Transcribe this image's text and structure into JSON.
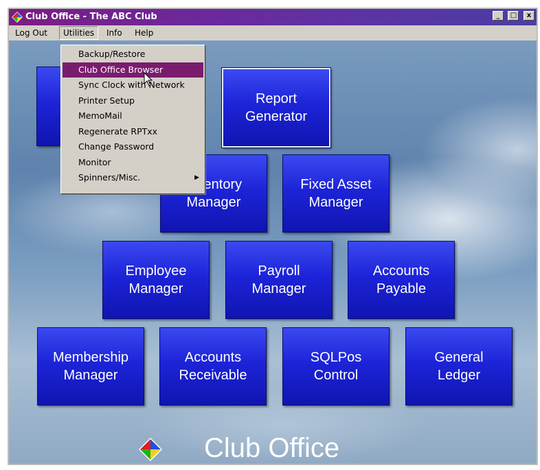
{
  "window": {
    "title": "Club Office - The ABC Club",
    "buttons": {
      "minimize": "_",
      "maximize": "□",
      "close": "x"
    }
  },
  "menubar": {
    "items": [
      {
        "label": "Log Out"
      },
      {
        "label": "Utilities",
        "active": true
      },
      {
        "label": "Info"
      },
      {
        "label": "Help"
      }
    ]
  },
  "utilities_menu": {
    "items": [
      {
        "label": "Backup/Restore"
      },
      {
        "label": "Club Office Browser",
        "highlighted": true
      },
      {
        "label": "Sync Clock with Network"
      },
      {
        "label": "Printer Setup"
      },
      {
        "label": "MemoMail"
      },
      {
        "label": "Regenerate RPTxx"
      },
      {
        "label": "Change Password"
      },
      {
        "label": "Monitor"
      },
      {
        "label": "Spinners/Misc.",
        "submenu": true
      }
    ]
  },
  "tiles": {
    "report_generator": "Report\nGenerator",
    "inventory_manager": "Inventory\nManager",
    "fixed_asset_manager": "Fixed Asset\nManager",
    "employee_manager": "Employee\nManager",
    "payroll_manager": "Payroll\nManager",
    "accounts_payable": "Accounts\nPayable",
    "membership_manager": "Membership\nManager",
    "accounts_receivable": "Accounts\nReceivable",
    "sqlpos_control": "SQLPos\nControl",
    "general_ledger": "General\nLedger"
  },
  "brand": {
    "text": "Club Office"
  },
  "colors": {
    "title_bar": "#7b1c82",
    "tile_blue": "#1d24d8",
    "menu_highlight": "#7a1c6e"
  },
  "icons": {
    "app": "diamond-logo-icon",
    "cursor": "mouse-pointer-icon",
    "submenu": "triangle-right-icon"
  }
}
